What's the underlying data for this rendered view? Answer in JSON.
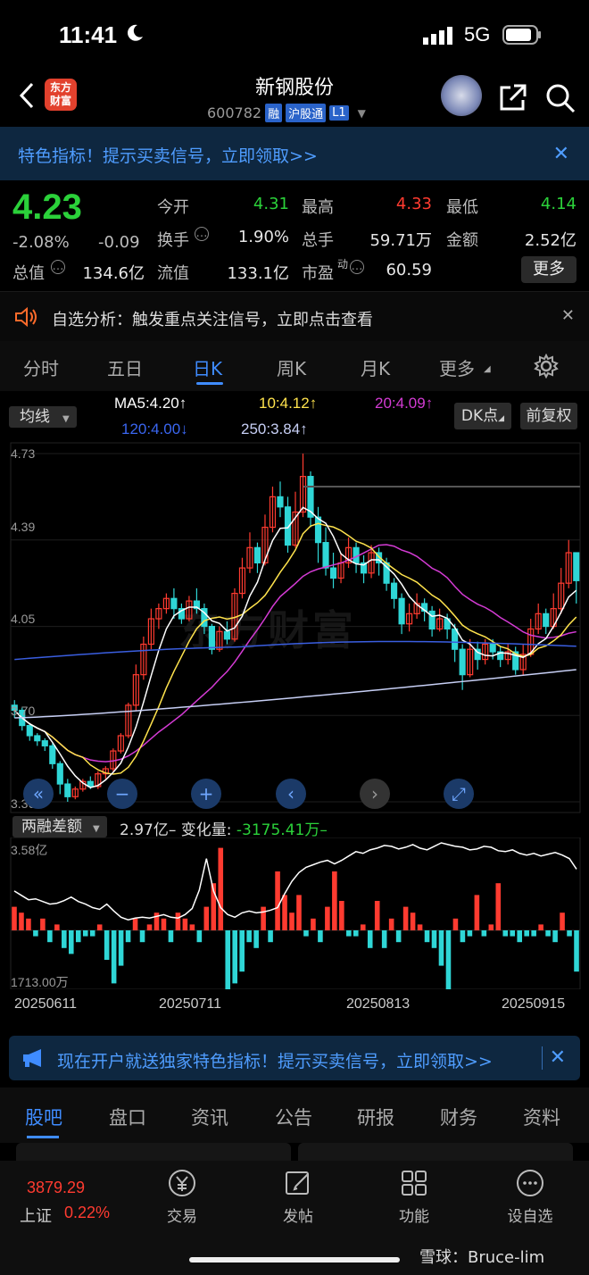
{
  "status_bar": {
    "time": "11:41",
    "network": "5G"
  },
  "header": {
    "logo_text_1": "东方",
    "logo_text_2": "财富",
    "stock_name": "新钢股份",
    "stock_code": "600782",
    "tags": [
      "融",
      "沪股通",
      "L1"
    ]
  },
  "promo": {
    "text": "特色指标！提示买卖信号，立即领取>>"
  },
  "quote": {
    "price": "4.23",
    "change_pct": "-2.08%",
    "change": "-0.09",
    "fields": {
      "open_label": "今开",
      "open": "4.31",
      "high_label": "最高",
      "high": "4.33",
      "low_label": "最低",
      "low": "4.14",
      "turnover_label": "换手",
      "turnover": "1.90%",
      "volume_label": "总手",
      "volume": "59.71万",
      "amount_label": "金额",
      "amount": "2.52亿",
      "mktcap_label": "总值",
      "mktcap": "134.6亿",
      "float_label": "流值",
      "float": "133.1亿",
      "pe_label": "市盈",
      "pe_sup": "动",
      "pe": "60.59"
    },
    "more": "更多"
  },
  "notice": {
    "text": "自选分析：触发重点关注信号，立即点击查看"
  },
  "kline_tabs": [
    "分时",
    "五日",
    "日K",
    "周K",
    "月K",
    "更多"
  ],
  "active_tab": "日K",
  "chart_toolbar": {
    "indicator": "均线",
    "ma5": "MA5:4.20↑",
    "ma10": "10:4.12↑",
    "ma20": "20:4.09↑",
    "ma120": "120:4.00↓",
    "ma250": "250:3.84↑",
    "dk": "DK点",
    "adjust": "前复权"
  },
  "colors": {
    "ma5": "#ffffff",
    "ma10": "#ffe34d",
    "ma20": "#d43bd4",
    "ma120": "#3a5ee0",
    "ma250": "#c7cff5",
    "up": "#ff3b30",
    "down": "#2fd6d6",
    "accent": "#3f8cff"
  },
  "chart_data": [
    {
      "type": "candlestick",
      "y_ticks": [
        "4.73",
        "4.39",
        "4.05",
        "3.70",
        "3.36"
      ],
      "ylim": [
        3.36,
        4.73
      ],
      "watermark": "东方财富",
      "candles": [
        [
          3.74,
          3.72,
          3.69,
          3.76
        ],
        [
          3.72,
          3.66,
          3.64,
          3.73
        ],
        [
          3.66,
          3.62,
          3.6,
          3.67
        ],
        [
          3.62,
          3.6,
          3.58,
          3.63
        ],
        [
          3.6,
          3.58,
          3.56,
          3.61
        ],
        [
          3.58,
          3.51,
          3.49,
          3.59
        ],
        [
          3.51,
          3.43,
          3.39,
          3.52
        ],
        [
          3.43,
          3.38,
          3.36,
          3.45
        ],
        [
          3.38,
          3.41,
          3.37,
          3.42
        ],
        [
          3.41,
          3.44,
          3.4,
          3.45
        ],
        [
          3.44,
          3.42,
          3.41,
          3.46
        ],
        [
          3.42,
          3.47,
          3.41,
          3.48
        ],
        [
          3.47,
          3.49,
          3.45,
          3.5
        ],
        [
          3.49,
          3.56,
          3.48,
          3.57
        ],
        [
          3.56,
          3.62,
          3.55,
          3.63
        ],
        [
          3.62,
          3.74,
          3.61,
          3.75
        ],
        [
          3.74,
          3.86,
          3.72,
          3.9
        ],
        [
          3.86,
          3.98,
          3.84,
          4.01
        ],
        [
          3.98,
          4.08,
          3.96,
          4.12
        ],
        [
          4.08,
          4.12,
          4.04,
          4.14
        ],
        [
          4.12,
          4.16,
          4.1,
          4.18
        ],
        [
          4.16,
          4.12,
          4.08,
          4.2
        ],
        [
          4.12,
          4.08,
          4.06,
          4.14
        ],
        [
          4.08,
          4.15,
          4.07,
          4.17
        ],
        [
          4.15,
          4.12,
          4.1,
          4.2
        ],
        [
          4.12,
          4.05,
          4.02,
          4.14
        ],
        [
          4.05,
          3.96,
          3.94,
          4.06
        ],
        [
          3.96,
          4.03,
          3.95,
          4.05
        ],
        [
          4.03,
          4.0,
          3.98,
          4.07
        ],
        [
          4.0,
          4.18,
          3.99,
          4.2
        ],
        [
          4.18,
          4.28,
          4.16,
          4.32
        ],
        [
          4.28,
          4.36,
          4.26,
          4.42
        ],
        [
          4.36,
          4.3,
          4.26,
          4.38
        ],
        [
          4.3,
          4.44,
          4.29,
          4.49
        ],
        [
          4.44,
          4.56,
          4.42,
          4.6
        ],
        [
          4.56,
          4.52,
          4.48,
          4.62
        ],
        [
          4.52,
          4.37,
          4.34,
          4.56
        ],
        [
          4.37,
          4.5,
          4.36,
          4.58
        ],
        [
          4.5,
          4.64,
          4.48,
          4.73
        ],
        [
          4.64,
          4.48,
          4.44,
          4.66
        ],
        [
          4.48,
          4.38,
          4.3,
          4.52
        ],
        [
          4.38,
          4.28,
          4.25,
          4.44
        ],
        [
          4.28,
          4.24,
          4.2,
          4.34
        ],
        [
          4.24,
          4.3,
          4.22,
          4.34
        ],
        [
          4.3,
          4.36,
          4.28,
          4.4
        ],
        [
          4.36,
          4.3,
          4.26,
          4.38
        ],
        [
          4.3,
          4.26,
          4.22,
          4.33
        ],
        [
          4.26,
          4.34,
          4.24,
          4.37
        ],
        [
          4.34,
          4.3,
          4.25,
          4.36
        ],
        [
          4.3,
          4.22,
          4.19,
          4.32
        ],
        [
          4.22,
          4.16,
          4.12,
          4.24
        ],
        [
          4.16,
          4.06,
          4.02,
          4.18
        ],
        [
          4.06,
          4.1,
          4.03,
          4.14
        ],
        [
          4.1,
          4.14,
          4.08,
          4.18
        ],
        [
          4.14,
          4.11,
          4.07,
          4.16
        ],
        [
          4.11,
          4.04,
          4.01,
          4.13
        ],
        [
          4.04,
          4.08,
          4.03,
          4.12
        ],
        [
          4.08,
          4.04,
          4.0,
          4.1
        ],
        [
          4.04,
          3.96,
          3.91,
          4.06
        ],
        [
          3.96,
          3.86,
          3.8,
          3.98
        ],
        [
          3.86,
          3.96,
          3.85,
          4.0
        ],
        [
          3.96,
          3.92,
          3.88,
          3.99
        ],
        [
          3.92,
          3.98,
          3.9,
          4.0
        ],
        [
          3.98,
          3.95,
          3.92,
          4.0
        ],
        [
          3.95,
          3.92,
          3.89,
          3.97
        ],
        [
          3.92,
          3.95,
          3.9,
          3.98
        ],
        [
          3.95,
          3.88,
          3.86,
          3.97
        ],
        [
          3.88,
          3.94,
          3.86,
          3.98
        ],
        [
          3.94,
          4.04,
          3.93,
          4.08
        ],
        [
          4.04,
          4.1,
          4.02,
          4.14
        ],
        [
          4.1,
          4.05,
          4.02,
          4.12
        ],
        [
          4.05,
          4.12,
          4.04,
          4.18
        ],
        [
          4.12,
          4.22,
          4.1,
          4.28
        ],
        [
          4.22,
          4.34,
          4.2,
          4.39
        ],
        [
          4.34,
          4.23,
          4.14,
          4.33
        ]
      ]
    },
    {
      "type": "bar",
      "title": "两融差额",
      "value_text": "2.97亿",
      "change_label": "变化量:",
      "change_value": "-3175.41万",
      "y_ticks": [
        "3.58亿",
        "1713.00万"
      ],
      "dates": [
        "20250611",
        "20250711",
        "20250813",
        "20250915"
      ],
      "bars": [
        4,
        3,
        2,
        -1,
        2,
        -2,
        1,
        -3,
        -4,
        -2,
        -1,
        -1,
        1,
        -5,
        -9,
        -6,
        -2,
        2,
        -2,
        1,
        3,
        2,
        -2,
        3,
        2,
        1,
        -2,
        4,
        8,
        14,
        -11,
        -9,
        -7,
        -2,
        -3,
        4,
        -2,
        10,
        6,
        3,
        6,
        -1,
        2,
        -2,
        4,
        10,
        5,
        -1,
        -1,
        1,
        -3,
        5,
        -3,
        2,
        -2,
        4,
        3,
        1,
        -2,
        -3,
        -6,
        -10,
        2,
        -2,
        -1,
        6,
        -1,
        1,
        8,
        -1,
        -1,
        -2,
        -1,
        -1,
        1,
        -1,
        -2,
        3,
        -1,
        -7
      ],
      "line": [
        0.45,
        0.4,
        0.35,
        0.36,
        0.33,
        0.3,
        0.31,
        0.34,
        0.38,
        0.33,
        0.3,
        0.26,
        0.24,
        0.3,
        0.22,
        0.15,
        0.12,
        0.14,
        0.15,
        0.14,
        0.16,
        0.18,
        0.15,
        0.14,
        0.18,
        0.25,
        0.46,
        0.82,
        0.45,
        0.26,
        0.18,
        0.15,
        0.2,
        0.22,
        0.2,
        0.21,
        0.23,
        0.26,
        0.42,
        0.56,
        0.66,
        0.72,
        0.75,
        0.78,
        0.8,
        0.76,
        0.8,
        0.85,
        0.9,
        0.88,
        0.92,
        0.94,
        0.97,
        0.96,
        0.93,
        0.95,
        0.98,
        0.94,
        0.92,
        0.96,
        1.0,
        0.98,
        0.96,
        0.95,
        0.92,
        0.93,
        0.96,
        0.95,
        0.91,
        0.9,
        0.92,
        0.88,
        0.86,
        0.88,
        0.85,
        0.87,
        0.89,
        0.86,
        0.82,
        0.7
      ]
    }
  ],
  "banner2": {
    "text": "现在开户就送独家特色指标！提示买卖信号，立即领取>>"
  },
  "section_tabs": [
    "股吧",
    "盘口",
    "资讯",
    "公告",
    "研报",
    "财务",
    "资料"
  ],
  "bottom_nav": {
    "index_value": "3879.29",
    "index_name": "上证",
    "index_change": "0.22%",
    "items": [
      "交易",
      "发帖",
      "功能",
      "设自选"
    ]
  },
  "credit": "雪球：Bruce-lim"
}
